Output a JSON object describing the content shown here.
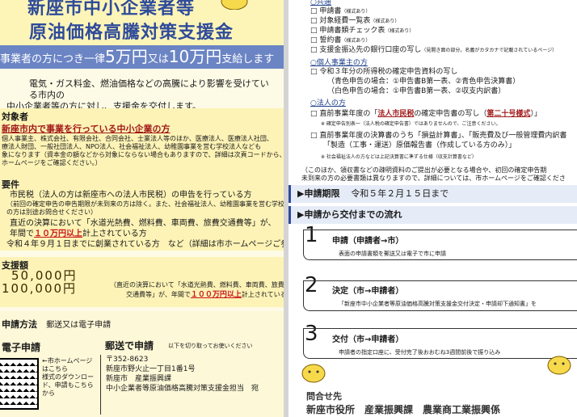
{
  "left_page": {
    "title_line1": "新座市中小企業者等",
    "title_line2": "原油価格高騰対策支援金",
    "banner": {
      "prefix": "事業者の方につき一律",
      "amount1": "5万円",
      "conj": "又は",
      "amount2": "10万円",
      "suffix": "支給します"
    },
    "intro": [
      "電気・ガス料金、燃油価格などの高騰により影響を受けている市内の",
      "中小企業者等の方に対し、支援金を交付します。"
    ],
    "target": {
      "heading": "対象者",
      "main": "新座市内で事業を行っている中小企業の方",
      "detail": [
        "個人事業主、株式会社、有限会社、合同会社、士業法人等のほか、医療法人、医療法人社団、",
        "療法人財団、一般社団法人、NPO法人、社会福祉法人、幼稚園事業を営む学校法人なども",
        "象になります（資本金の額などから対象にならない場合もありますので、詳細は次頁コードから、",
        "ホームページをご確認ください。）"
      ]
    },
    "requirements": {
      "heading": "要件",
      "req1": "市民税（法人の方は新座市への法人市民税）の申告を行っている方",
      "req1_note": [
        "（前回の確定申告の申告期限が未到来の方は除く。また、社会福祉法人、幼稚園事業を営む学校法人",
        "の方は別途お問合せください）"
      ],
      "req2_a": "直近の決算において「水道光熱費、燃料費、車両費、旅費交通費等」が、",
      "req2_b_pre": "年間で",
      "req2_b_amount": "１０万円以上",
      "req2_b_post": "計上されている方",
      "req3": "令和４年９月１日までに創業されている方　など（詳細は市ホームページご参照）"
    },
    "amount": {
      "heading": "支援額",
      "a1": "50,000円",
      "a2": "100,000円",
      "a2_note_pre": "（直近の決算において「水道光熱費、燃料費、車両費、旅費",
      "a2_note2_pre": "交通費等」が、年間で",
      "a2_note2_amount": "１００万円以上",
      "a2_note2_post": "計上されている方）"
    },
    "method": {
      "heading": "申請方法",
      "text": "郵送又は電子申請",
      "electronic_label": "電子申請",
      "electronic_desc": [
        "←市ホームページ",
        "はこちら",
        "様式のダウンロー",
        "ド、申請もこちら",
        "から"
      ],
      "mail_label": "郵送で申請",
      "mail_hint": "以下を切り取ってお使いください",
      "address": [
        "〒352-8623",
        "新座市野火止一丁目1番1号",
        "新座市　産業振興課",
        "中小企業者等原油価格高騰対策支援金担当　宛"
      ]
    }
  },
  "right_page": {
    "common_header": "○共通",
    "common_items": [
      {
        "label": "申請書",
        "note": "（様式あり）"
      },
      {
        "label": "対象経費一覧表",
        "note": "（様式あり）"
      },
      {
        "label": "申請書類チェック表",
        "note": "（様式あり）"
      },
      {
        "label": "誓約書",
        "note": "（様式あり）"
      },
      {
        "label": "支援金振込先の銀行口座の写し",
        "note": "（見開き面の部分。名義がカタカナで記載されているページ）"
      }
    ],
    "individual_header": "○個人事業主の方",
    "individual_items": [
      "令和３年分の所得税の確定申告資料の写し",
      "（青色申告の場合：①申告書B第一表、②青色申告決算書）",
      "（白色申告の場合：①申告書B第一表、②収支内訳書）"
    ],
    "corporate_header": "○法人の方",
    "corp1_pre": "直前事業年度の「",
    "corp1_bold": "法人市民税",
    "corp1_mid": "の確定申告書の写し（",
    "corp1_form": "第二十号様式",
    "corp1_post": "）」",
    "corp1_note": "※ 確定申告別表一（法人税の確定申告書）ではありませんので、ご注意ください。",
    "corp2_a": "直前事業年度の決算書のうち「損益計算書」、「販売費及び一般管理費内訳書",
    "corp2_b": "「製造（工事・運送）原価報告書（作成している方のみ）」",
    "corp2_note": "※ 社会福祉法人の方などは上記決算書に準ずる仕様（収支計算書など）",
    "extra_note": [
      "（このほか、領収書などの疎明資料のご提出が必要となる場合や、初回の確定申告期",
      "未到来の方の必要書類は異なりますので、詳細については、市ホームページをご確認くださ"
    ],
    "deadline_label": "▶申請期限",
    "deadline_value": "令和５年２月１５日まで",
    "flow_header": "▶申請から交付までの流れ",
    "steps": [
      {
        "num": "1",
        "title": "申請（申請者→市）",
        "desc": "表面の申請書類を郵送又は電子で市に申請"
      },
      {
        "num": "2",
        "title": "決定（市→申請者）",
        "desc": "「新座市中小企業者等原油価格高騰対策支援金交付決定・申請却下通知書」を"
      },
      {
        "num": "3",
        "title": "交付（市→申請者）",
        "desc": "申請者の指定口座に、受付完了後おおむね3週間前後で振り込み"
      }
    ],
    "inquiry_label": "問合せ先",
    "inquiry_value": "新座市役所　産業振興課　農業商工業振興係"
  }
}
